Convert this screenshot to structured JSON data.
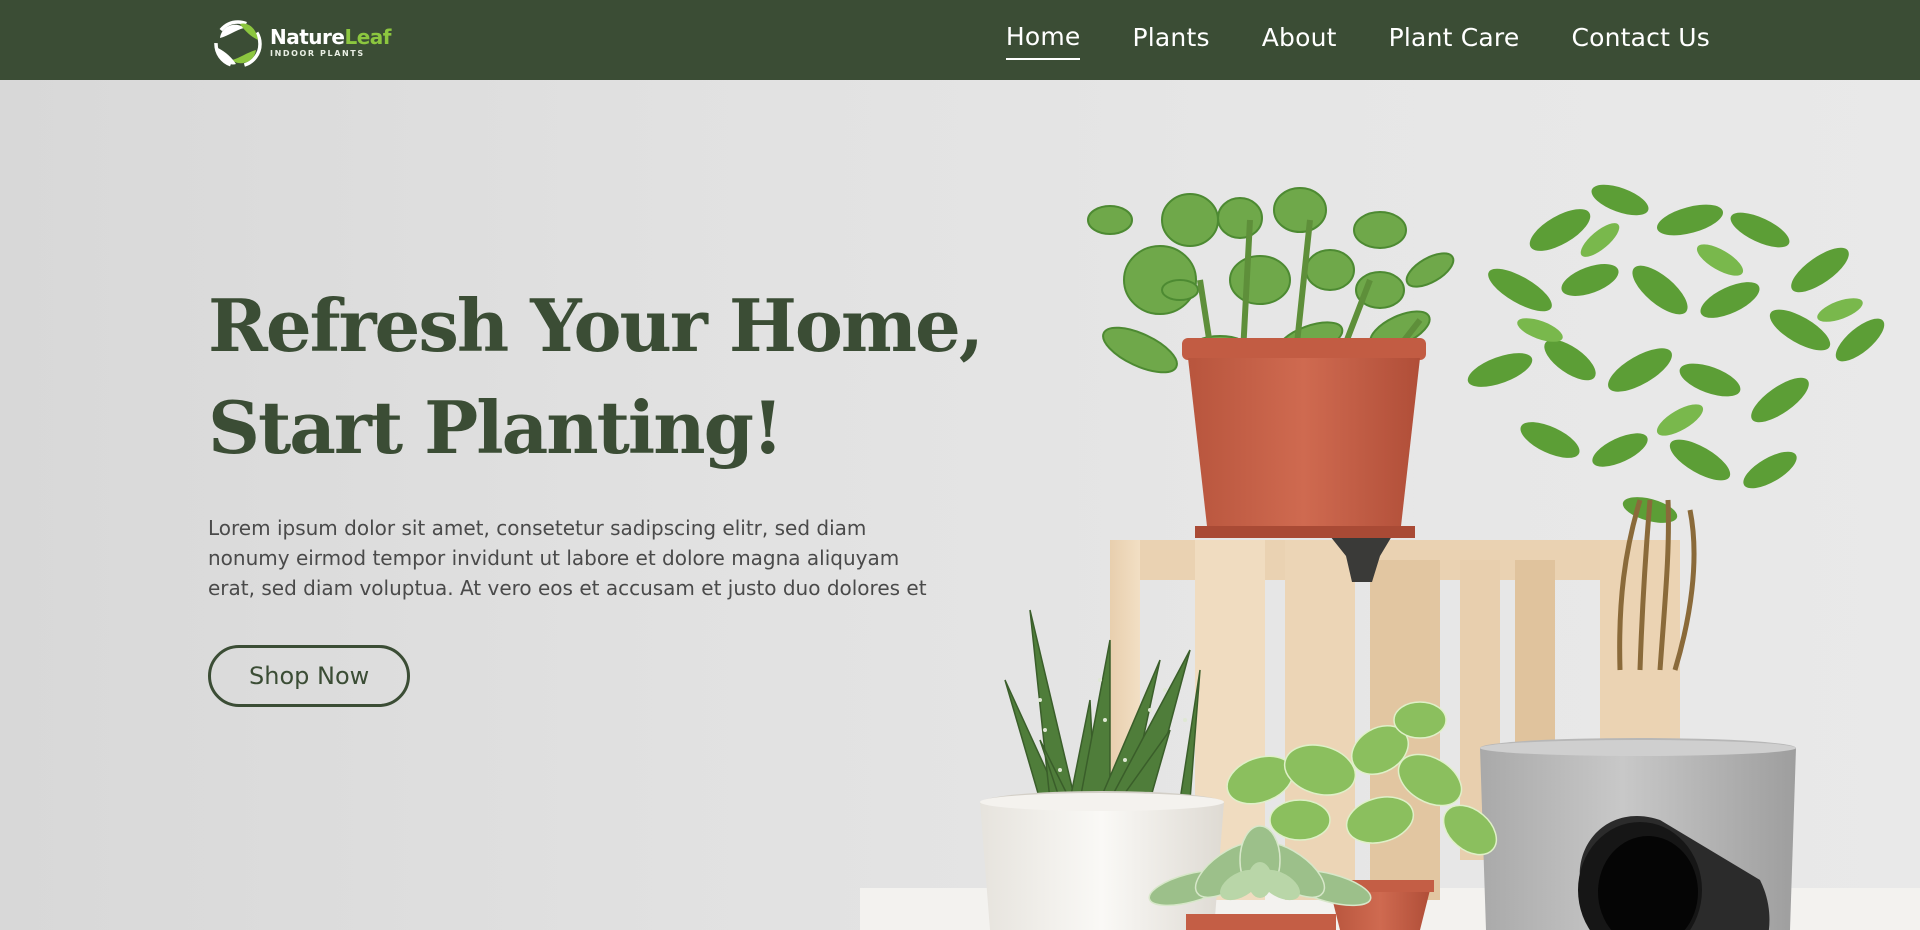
{
  "brand": {
    "name_part1": "Nature",
    "name_part2": "Leaf",
    "tagline": "INDOOR PLANTS",
    "colors": {
      "primary": "#3b4d35",
      "accent": "#8cc63f",
      "nav_text": "#ffffff"
    }
  },
  "nav": {
    "items": [
      {
        "label": "Home",
        "active": true
      },
      {
        "label": "Plants",
        "active": false
      },
      {
        "label": "About",
        "active": false
      },
      {
        "label": "Plant Care",
        "active": false
      },
      {
        "label": "Contact Us",
        "active": false
      }
    ]
  },
  "hero": {
    "headline_line1": "Refresh Your Home,",
    "headline_line2": "Start Planting!",
    "body": "Lorem ipsum dolor sit amet, consetetur sadipscing elitr, sed diam nonumy eirmod tempor invidunt ut labore et dolore magna aliquyam erat, sed diam voluptua. At vero eos et accusam et justo duo dolores et",
    "cta_label": "Shop Now",
    "image": "potted-plants-illustration"
  }
}
